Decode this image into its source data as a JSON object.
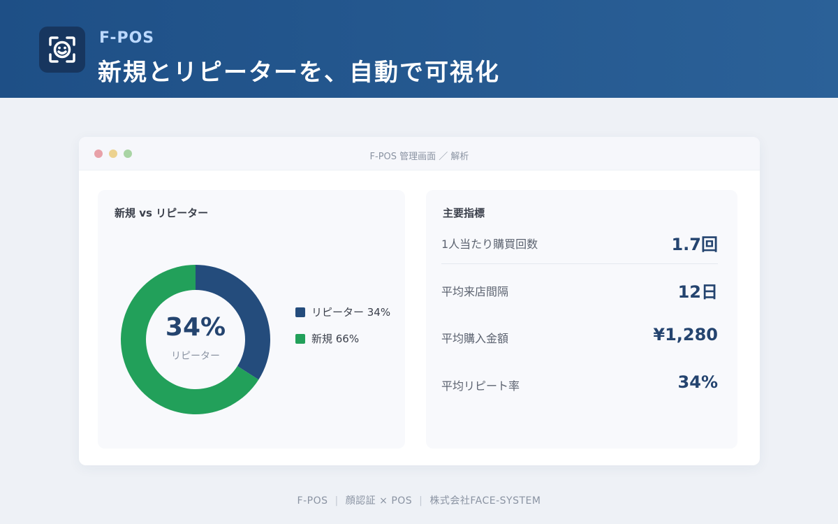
{
  "header": {
    "brand": "F-POS",
    "headline": "新規とリピーターを、自動で可視化"
  },
  "window": {
    "title": "F-POS 管理画面 ／ 解析"
  },
  "chart_panel": {
    "title": "新規 vs リピーター",
    "center_value": "34%",
    "center_label": "リピーター",
    "legend": [
      {
        "label": "リピーター 34%"
      },
      {
        "label": "新規 66%"
      }
    ]
  },
  "chart_data": {
    "type": "pie",
    "categories": [
      "リピーター",
      "新規"
    ],
    "values": [
      34,
      66
    ],
    "colors": [
      "#244c7c",
      "#22a05a"
    ],
    "donut": true
  },
  "metrics_panel": {
    "title": "主要指標",
    "items": [
      {
        "label": "1人当たり購買回数",
        "value": "1.7回"
      },
      {
        "label": "平均来店間隔",
        "value": "12日"
      },
      {
        "label": "平均購入金額",
        "value": "¥1,280"
      },
      {
        "label": "平均リピート率",
        "value": "34%"
      }
    ]
  },
  "footer": {
    "parts": [
      "F-POS",
      "顔認証 × POS",
      "株式会社FACE-SYSTEM"
    ]
  },
  "colors": {
    "header_start": "#1e4f86",
    "header_end": "#2b6198",
    "brand_text": "#bcd9ff",
    "repeater": "#244c7c",
    "new": "#22a05a"
  },
  "icons": {
    "logo": "face-recognition-icon"
  }
}
